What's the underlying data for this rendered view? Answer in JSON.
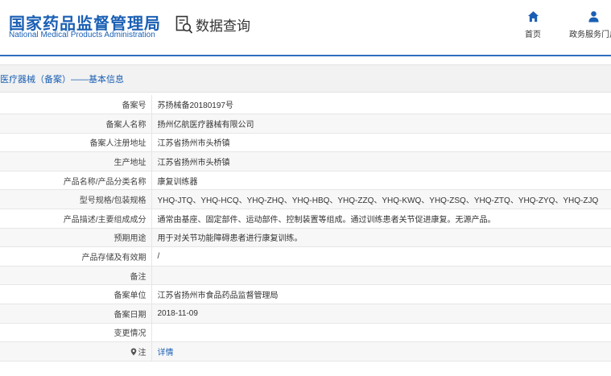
{
  "header": {
    "logo_cn": "国家药品监督管理局",
    "logo_en": "National Medical Products Administration",
    "query_label": "数据查询",
    "query_icon": "search-document-icon",
    "nav": [
      {
        "label": "首页",
        "icon": "home-icon"
      },
      {
        "label": "政务服务门户",
        "icon": "user-icon"
      }
    ]
  },
  "breadcrumb": "医疗器械（备案）——基本信息",
  "rows": [
    {
      "label": "备案号",
      "value": "苏扬械备20180197号"
    },
    {
      "label": "备案人名称",
      "value": "扬州亿航医疗器械有限公司"
    },
    {
      "label": "备案人注册地址",
      "value": "江苏省扬州市头桥镇"
    },
    {
      "label": "生产地址",
      "value": "江苏省扬州市头桥镇"
    },
    {
      "label": "产品名称/产品分类名称",
      "value": "康复训练器"
    },
    {
      "label": "型号规格/包装规格",
      "value": "YHQ-JTQ、YHQ-HCQ、YHQ-ZHQ、YHQ-HBQ、YHQ-ZZQ、YHQ-KWQ、YHQ-ZSQ、YHQ-ZTQ、YHQ-ZYQ、YHQ-ZJQ"
    },
    {
      "label": "产品描述/主要组成成分",
      "value": "通常由基座、固定部件、运动部件、控制装置等组成。通过训练患者关节促进康复。无源产品。"
    },
    {
      "label": "预期用途",
      "value": "用于对关节功能障碍患者进行康复训练。"
    },
    {
      "label": "产品存储及有效期",
      "value": "/"
    },
    {
      "label": "备注",
      "value": ""
    },
    {
      "label": "备案单位",
      "value": "江苏省扬州市食品药品监督管理局"
    },
    {
      "label": "备案日期",
      "value": "2018-11-09"
    },
    {
      "label": "变更情况",
      "value": ""
    },
    {
      "label": "注",
      "value": "详情"
    }
  ],
  "colors": {
    "brand_blue": "#1a5fb4",
    "rule_blue": "#2f6fbf"
  }
}
